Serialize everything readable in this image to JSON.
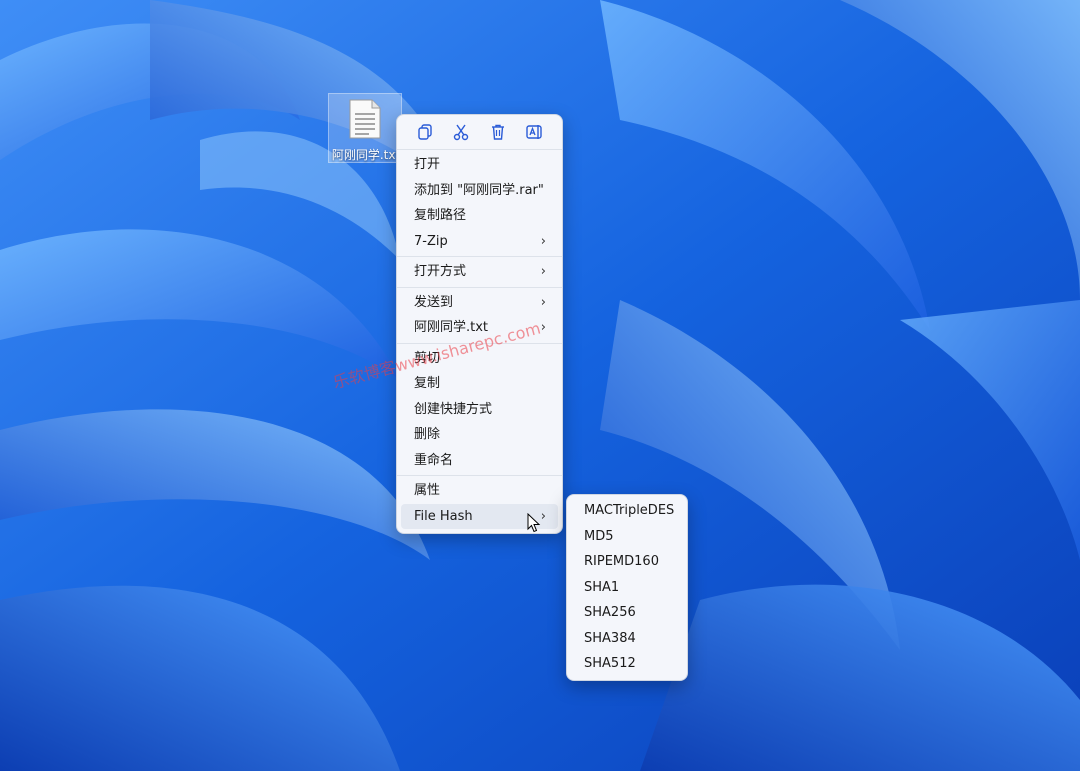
{
  "desktop": {
    "file_label": "阿刚同学.txt"
  },
  "watermark": {
    "text": "乐软博客www.isharepc.com"
  },
  "context_menu": {
    "toolbar": [
      {
        "icon": "copy-icon"
      },
      {
        "icon": "cut-icon"
      },
      {
        "icon": "delete-icon"
      },
      {
        "icon": "rename-icon"
      }
    ],
    "group1": [
      {
        "label": "打开",
        "submenu": false
      },
      {
        "label": "添加到 \"阿刚同学.rar\"",
        "submenu": false
      },
      {
        "label": "复制路径",
        "submenu": false
      },
      {
        "label": "7-Zip",
        "submenu": true
      }
    ],
    "group2": [
      {
        "label": "打开方式",
        "submenu": true
      }
    ],
    "group3": [
      {
        "label": "发送到",
        "submenu": true
      },
      {
        "label": "阿刚同学.txt",
        "submenu": true
      }
    ],
    "group4": [
      {
        "label": "剪切",
        "submenu": false
      },
      {
        "label": "复制",
        "submenu": false
      },
      {
        "label": "创建快捷方式",
        "submenu": false
      },
      {
        "label": "删除",
        "submenu": false
      },
      {
        "label": "重命名",
        "submenu": false
      }
    ],
    "group5": [
      {
        "label": "属性",
        "submenu": false
      },
      {
        "label": "File Hash",
        "submenu": true,
        "active": true
      }
    ]
  },
  "hash_submenu": {
    "items": [
      "MACTripleDES",
      "MD5",
      "RIPEMD160",
      "SHA1",
      "SHA256",
      "SHA384",
      "SHA512"
    ]
  },
  "colors": {
    "wallpaper_base": "#1565d8",
    "menu_bg": "#f4f6fb",
    "watermark": "#eb3c46"
  }
}
